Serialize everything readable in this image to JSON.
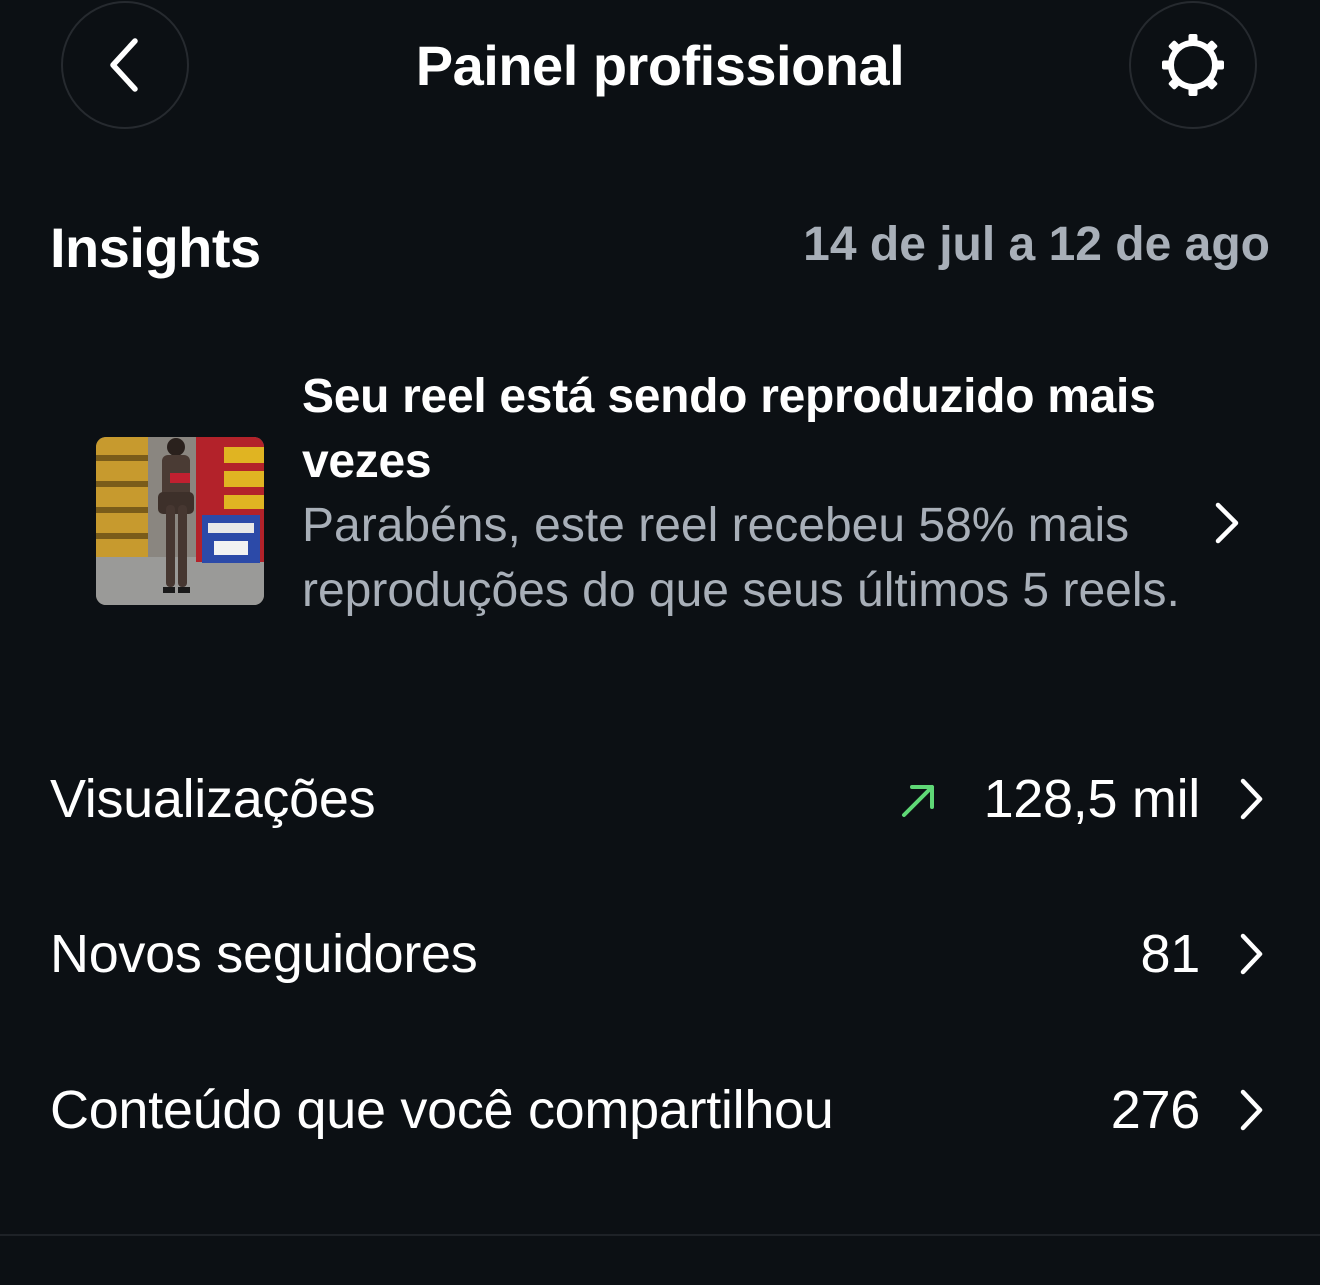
{
  "header": {
    "title": "Painel profissional",
    "back_icon": "chevron-left-icon",
    "settings_icon": "gear-icon"
  },
  "insights": {
    "title": "Insights",
    "date_range": "14 de jul a 12 de ago"
  },
  "reel_card": {
    "title": "Seu reel está sendo reproduzido mais vezes",
    "description": "Parabéns, este reel recebeu 58% mais reproduções do que seus últimos 5 reels.",
    "thumbnail": "reel-thumbnail-image"
  },
  "metrics": [
    {
      "label": "Visualizações",
      "value": "128,5 mil",
      "trend": "up",
      "trend_color": "#5fd876"
    },
    {
      "label": "Novos seguidores",
      "value": "81"
    },
    {
      "label": "Conteúdo que você compartilhou",
      "value": "276"
    }
  ],
  "colors": {
    "background": "#0c1014",
    "primary_text": "#ffffff",
    "secondary_text": "#a8afb8",
    "trend_up": "#5fd876"
  }
}
